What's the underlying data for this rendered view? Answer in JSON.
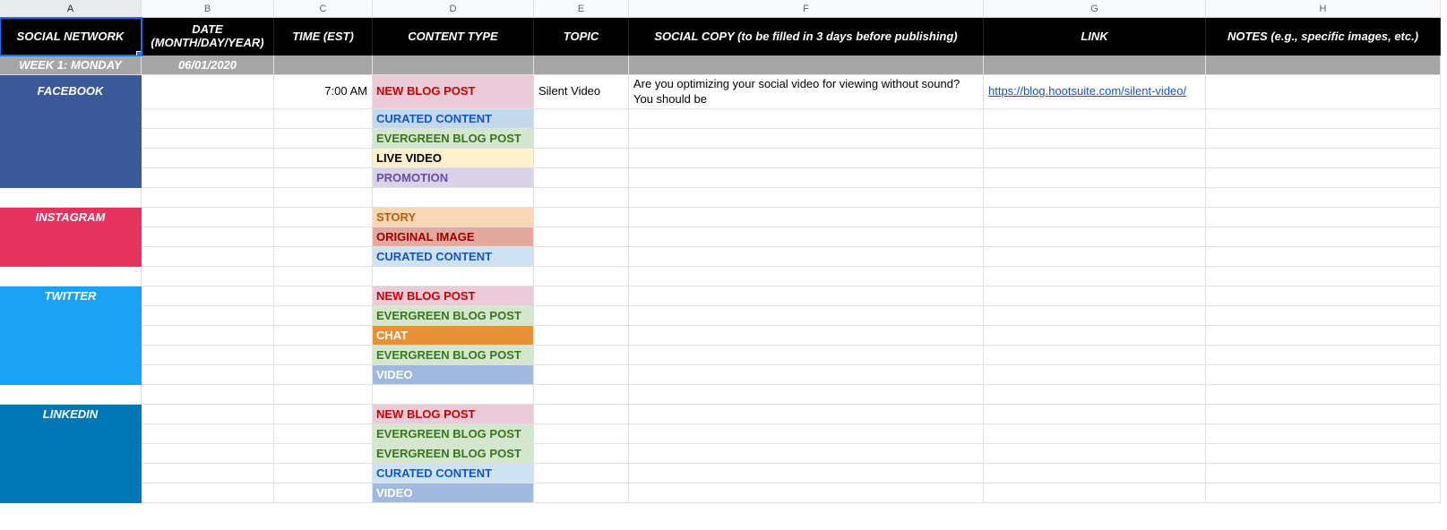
{
  "columns": {
    "A": "A",
    "B": "B",
    "C": "C",
    "D": "D",
    "E": "E",
    "F": "F",
    "G": "G",
    "H": "H"
  },
  "headers": {
    "social_network": "SOCIAL NETWORK",
    "date": "DATE (MONTH/DAY/YEAR)",
    "time": "TIME (EST)",
    "content_type": "CONTENT TYPE",
    "topic": "TOPIC",
    "social_copy": "SOCIAL COPY (to be filled in 3 days before publishing)",
    "link": "LINK",
    "notes": "NOTES (e.g., specific images, etc.)"
  },
  "week": {
    "label": "WEEK 1: MONDAY",
    "date": "06/01/2020"
  },
  "networks": {
    "facebook": "FACEBOOK",
    "instagram": "INSTAGRAM",
    "twitter": "TWITTER",
    "linkedin": "LINKEDIN"
  },
  "tags": {
    "new_blog": "NEW BLOG POST",
    "curated": "CURATED CONTENT",
    "evergreen": "EVERGREEN BLOG POST",
    "live_video": "LIVE VIDEO",
    "promotion": "PROMOTION",
    "story": "STORY",
    "original_image": "ORIGINAL IMAGE",
    "chat": "CHAT",
    "video": "VIDEO"
  },
  "fb_row1": {
    "time": "7:00 AM",
    "topic": "Silent Video",
    "copy": "Are you optimizing your social video for viewing without sound? You should be",
    "link": "https://blog.hootsuite.com/silent-video/"
  }
}
